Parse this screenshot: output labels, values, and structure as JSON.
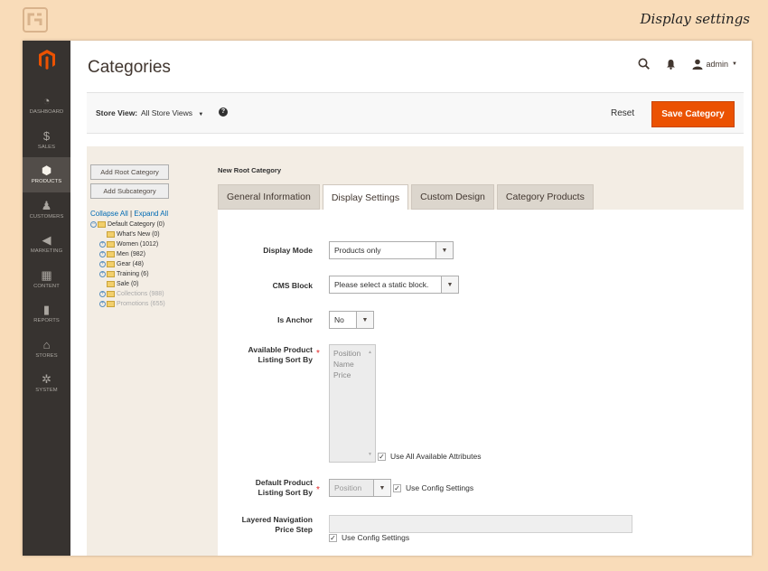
{
  "caption": "Display settings",
  "page": {
    "title": "Categories"
  },
  "topbar": {
    "user": "admin",
    "search_icon": "search-icon",
    "bell_icon": "bell-icon",
    "user_icon": "user-icon"
  },
  "sidebar": {
    "items": [
      {
        "label": "DASHBOARD",
        "icon": "dashboard-icon",
        "glyph": "◔"
      },
      {
        "label": "SALES",
        "icon": "dollar-icon",
        "glyph": "$"
      },
      {
        "label": "PRODUCTS",
        "icon": "box-icon",
        "glyph": "⬢"
      },
      {
        "label": "CUSTOMERS",
        "icon": "person-icon",
        "glyph": "♟"
      },
      {
        "label": "MARKETING",
        "icon": "megaphone-icon",
        "glyph": "◀"
      },
      {
        "label": "CONTENT",
        "icon": "layout-icon",
        "glyph": "▦"
      },
      {
        "label": "REPORTS",
        "icon": "bar-chart-icon",
        "glyph": "▮"
      },
      {
        "label": "STORES",
        "icon": "store-icon",
        "glyph": "⌂"
      },
      {
        "label": "SYSTEM",
        "icon": "gear-icon",
        "glyph": "✲"
      }
    ],
    "active_index": 2
  },
  "store_bar": {
    "label": "Store View:",
    "value": "All Store Views",
    "reset": "Reset",
    "save": "Save Category"
  },
  "left_panel": {
    "add_root": "Add Root Category",
    "add_sub": "Add Subcategory",
    "collapse_all": "Collapse All",
    "separator": "|",
    "expand_all": "Expand All",
    "tree": [
      {
        "label": "Default Category (0)",
        "level": 1,
        "expander": "minus",
        "dim": false
      },
      {
        "label": "What's New (0)",
        "level": 2,
        "expander": "none",
        "dim": false
      },
      {
        "label": "Women (1012)",
        "level": 2,
        "expander": "plus",
        "dim": false
      },
      {
        "label": "Men (982)",
        "level": 2,
        "expander": "plus",
        "dim": false
      },
      {
        "label": "Gear (48)",
        "level": 2,
        "expander": "plus",
        "dim": false
      },
      {
        "label": "Training (6)",
        "level": 2,
        "expander": "plus",
        "dim": false
      },
      {
        "label": "Sale (0)",
        "level": 2,
        "expander": "none",
        "dim": false
      },
      {
        "label": "Collections (988)",
        "level": 2,
        "expander": "plus",
        "dim": true
      },
      {
        "label": "Promotions (655)",
        "level": 2,
        "expander": "plus",
        "dim": true
      }
    ]
  },
  "section_title": "New Root Category",
  "tabs": [
    "General Information",
    "Display Settings",
    "Custom Design",
    "Category Products"
  ],
  "active_tab": 1,
  "form": {
    "display_mode": {
      "label": "Display Mode",
      "value": "Products only"
    },
    "cms_block": {
      "label": "CMS Block",
      "value": "Please select a static block."
    },
    "is_anchor": {
      "label": "Is Anchor",
      "value": "No"
    },
    "sort_by": {
      "label_line1": "Available Product",
      "label_line2": "Listing Sort By",
      "options": [
        "Position",
        "Name",
        "Price"
      ],
      "use_all": "Use All Available Attributes",
      "use_all_checked": true
    },
    "default_sort": {
      "label_line1": "Default Product",
      "label_line2": "Listing Sort By",
      "value": "Position",
      "use_config": "Use Config Settings",
      "checked": true
    },
    "layered_step": {
      "label_line1": "Layered Navigation",
      "label_line2": "Price Step",
      "value": "",
      "use_config": "Use Config Settings",
      "checked": true
    }
  },
  "colors": {
    "accent": "#eb5202",
    "sidebar_bg": "#373330",
    "page_bg": "#f9dcb9"
  }
}
